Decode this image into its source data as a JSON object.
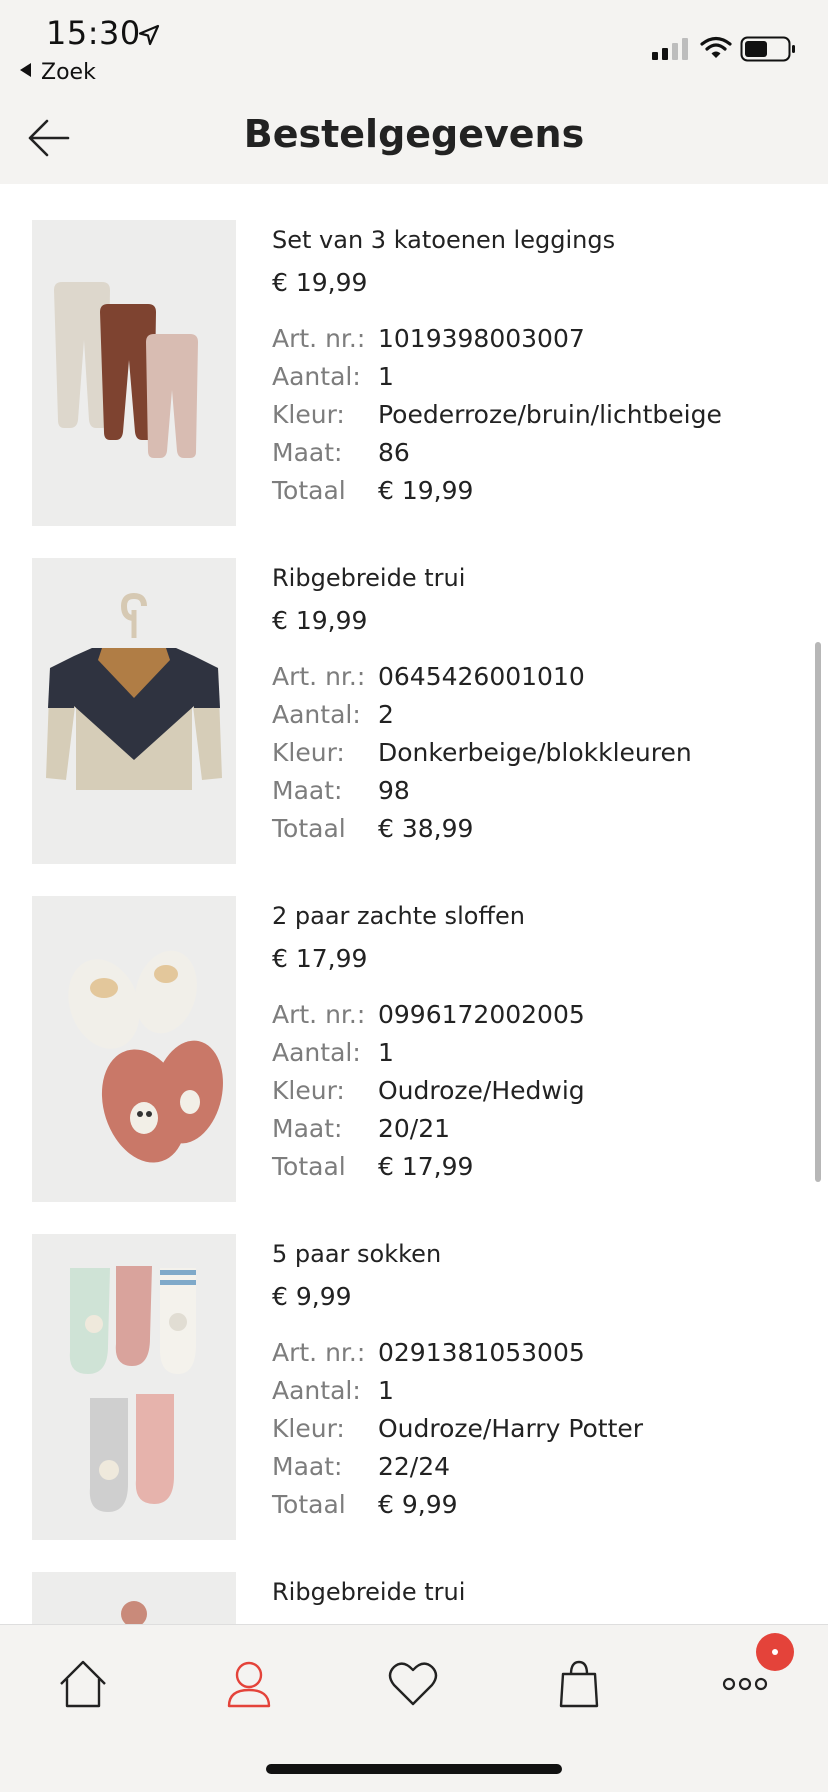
{
  "status_bar": {
    "time": "15:30",
    "back_app": "Zoek"
  },
  "header": {
    "title": "Bestelgegevens"
  },
  "products": [
    {
      "name": "Set van 3 katoenen leggings",
      "price": "€ 19,99",
      "specs": [
        {
          "label": "Art. nr.:",
          "value": "1019398003007"
        },
        {
          "label": "Aantal:",
          "value": "1"
        },
        {
          "label": "Kleur:",
          "value": "Poederroze/bruin/lichtbeige"
        },
        {
          "label": "Maat:",
          "value": "86"
        },
        {
          "label": "Totaal",
          "value": "€ 19,99"
        }
      ]
    },
    {
      "name": "Ribgebreide trui",
      "price": "€ 19,99",
      "specs": [
        {
          "label": "Art. nr.:",
          "value": "0645426001010"
        },
        {
          "label": "Aantal:",
          "value": "2"
        },
        {
          "label": "Kleur:",
          "value": "Donkerbeige/blokkleuren"
        },
        {
          "label": "Maat:",
          "value": "98"
        },
        {
          "label": "Totaal",
          "value": "€ 38,99"
        }
      ]
    },
    {
      "name": "2 paar zachte sloffen",
      "price": "€ 17,99",
      "specs": [
        {
          "label": "Art. nr.:",
          "value": "0996172002005"
        },
        {
          "label": "Aantal:",
          "value": "1"
        },
        {
          "label": "Kleur:",
          "value": "Oudroze/Hedwig"
        },
        {
          "label": "Maat:",
          "value": "20/21"
        },
        {
          "label": "Totaal",
          "value": "€ 17,99"
        }
      ]
    },
    {
      "name": "5 paar sokken",
      "price": "€ 9,99",
      "specs": [
        {
          "label": "Art. nr.:",
          "value": "0291381053005"
        },
        {
          "label": "Aantal:",
          "value": "1"
        },
        {
          "label": "Kleur:",
          "value": "Oudroze/Harry Potter"
        },
        {
          "label": "Maat:",
          "value": "22/24"
        },
        {
          "label": "Totaal",
          "value": "€ 9,99"
        }
      ]
    },
    {
      "name": "Ribgebreide trui"
    }
  ],
  "tab_bar": {
    "icons": [
      "home-icon",
      "account-icon",
      "heart-icon",
      "shopping-bag-icon",
      "more-icon"
    ],
    "active": "account-icon",
    "accent_color": "#e4433a"
  },
  "colors": {
    "header_bg": "#f4f3f1",
    "image_bg": "#ededec",
    "label_grey": "#7d7d7d"
  }
}
